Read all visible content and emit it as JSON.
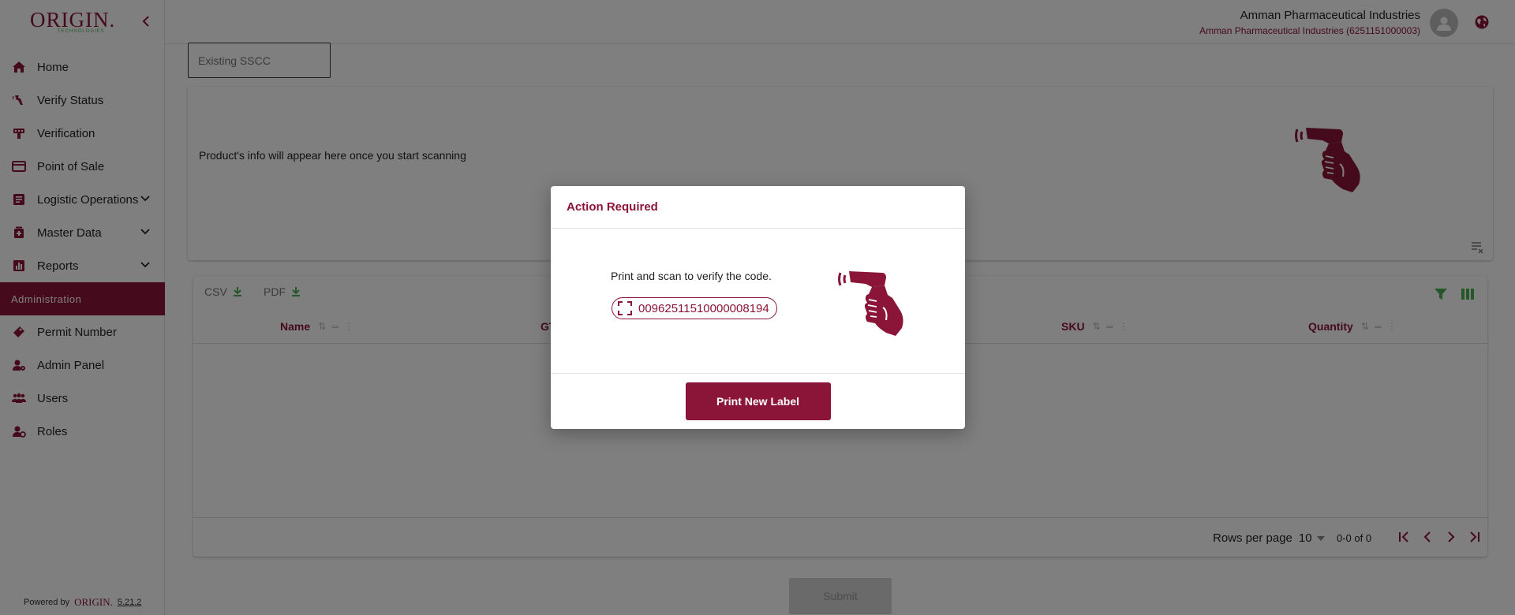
{
  "brand": {
    "logo": "ORIGIN.",
    "logo_sub": "TECHNOLOGIES",
    "powered_by": "Powered by",
    "powered_brand": "ORIGIN.",
    "version": "5.21.2",
    "accent_color": "#8b1538",
    "green_color": "#4caf50"
  },
  "sidebar": {
    "items": [
      {
        "label": "Home",
        "icon": "home-icon"
      },
      {
        "label": "Verify Status",
        "icon": "verify-status-icon"
      },
      {
        "label": "Verification",
        "icon": "verification-icon"
      },
      {
        "label": "Point of Sale",
        "icon": "card-icon"
      },
      {
        "label": "Logistic Operations",
        "icon": "logistics-icon",
        "expandable": true
      },
      {
        "label": "Master Data",
        "icon": "master-data-icon",
        "expandable": true
      },
      {
        "label": "Reports",
        "icon": "reports-icon",
        "expandable": true
      }
    ],
    "section": "Administration",
    "admin_items": [
      {
        "label": "Permit Number",
        "icon": "permit-icon"
      },
      {
        "label": "Admin Panel",
        "icon": "admin-panel-icon"
      },
      {
        "label": "Users",
        "icon": "users-icon"
      },
      {
        "label": "Roles",
        "icon": "roles-icon"
      }
    ]
  },
  "header": {
    "company": "Amman Pharmaceutical Industries",
    "company_sub": "Amman Pharmaceutical Industries (6251151000003)"
  },
  "main": {
    "sscc_placeholder": "Existing SSCC",
    "info_text": "Product's info will appear here once you start scanning",
    "export_csv": "CSV",
    "export_pdf": "PDF",
    "columns": [
      "Name",
      "GTIN",
      "SKU",
      "Quantity"
    ],
    "rows_per_page_label": "Rows per page",
    "rows_per_page": "10",
    "range": "0-0 of 0",
    "submit": "Submit"
  },
  "modal": {
    "title": "Action Required",
    "message": "Print and scan to verify the code.",
    "code": "00962511510000008194",
    "button": "Print New Label"
  }
}
